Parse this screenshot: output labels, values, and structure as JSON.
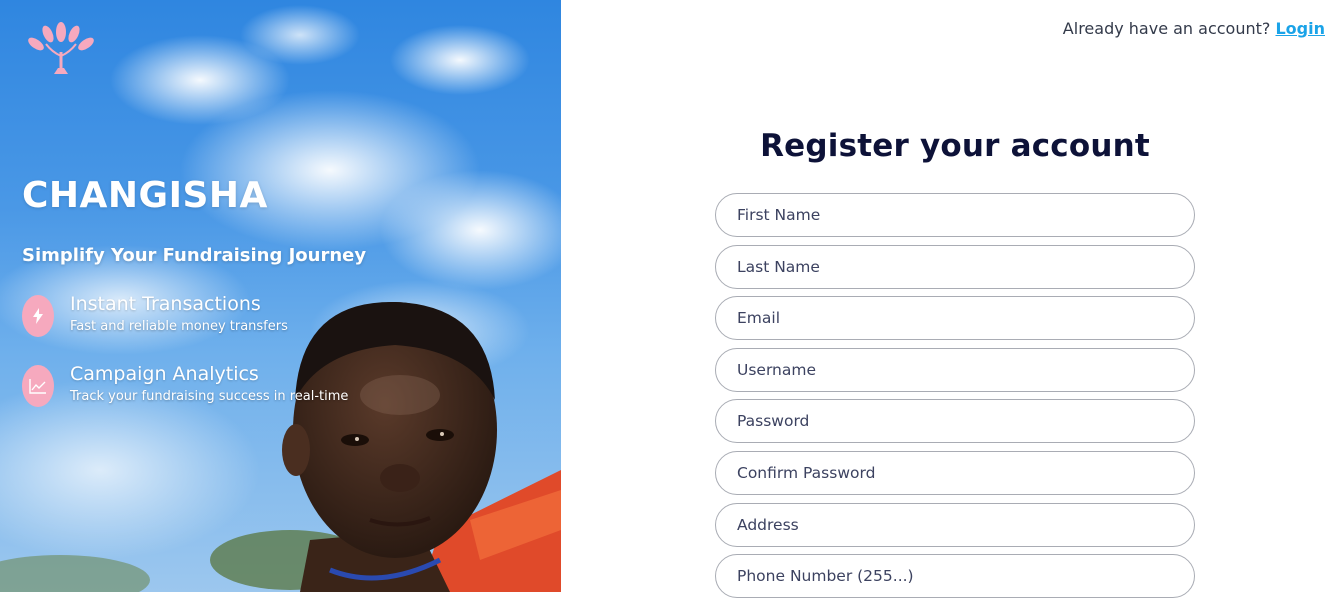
{
  "hero": {
    "brand": "CHANGISHA",
    "tagline": "Simplify Your Fundraising Journey",
    "features": [
      {
        "title": "Instant Transactions",
        "subtitle": "Fast and reliable money transfers",
        "icon": "lightning-icon"
      },
      {
        "title": "Campaign Analytics",
        "subtitle": "Track your fundraising success in real-time",
        "icon": "chart-line-icon"
      }
    ],
    "logo_icon": "tree-leaves-icon"
  },
  "header": {
    "prompt": "Already have an account?",
    "login_label": "Login"
  },
  "form": {
    "title": "Register your account",
    "fields": [
      {
        "placeholder": "First Name",
        "value": ""
      },
      {
        "placeholder": "Last Name",
        "value": ""
      },
      {
        "placeholder": "Email",
        "value": ""
      },
      {
        "placeholder": "Username",
        "value": ""
      },
      {
        "placeholder": "Password",
        "value": ""
      },
      {
        "placeholder": "Confirm Password",
        "value": ""
      },
      {
        "placeholder": "Address",
        "value": ""
      },
      {
        "placeholder": "Phone Number (255...)",
        "value": ""
      }
    ]
  },
  "colors": {
    "accent": "#1aa3e8",
    "title": "#0d1238",
    "icon_bg": "#f6a9be"
  }
}
